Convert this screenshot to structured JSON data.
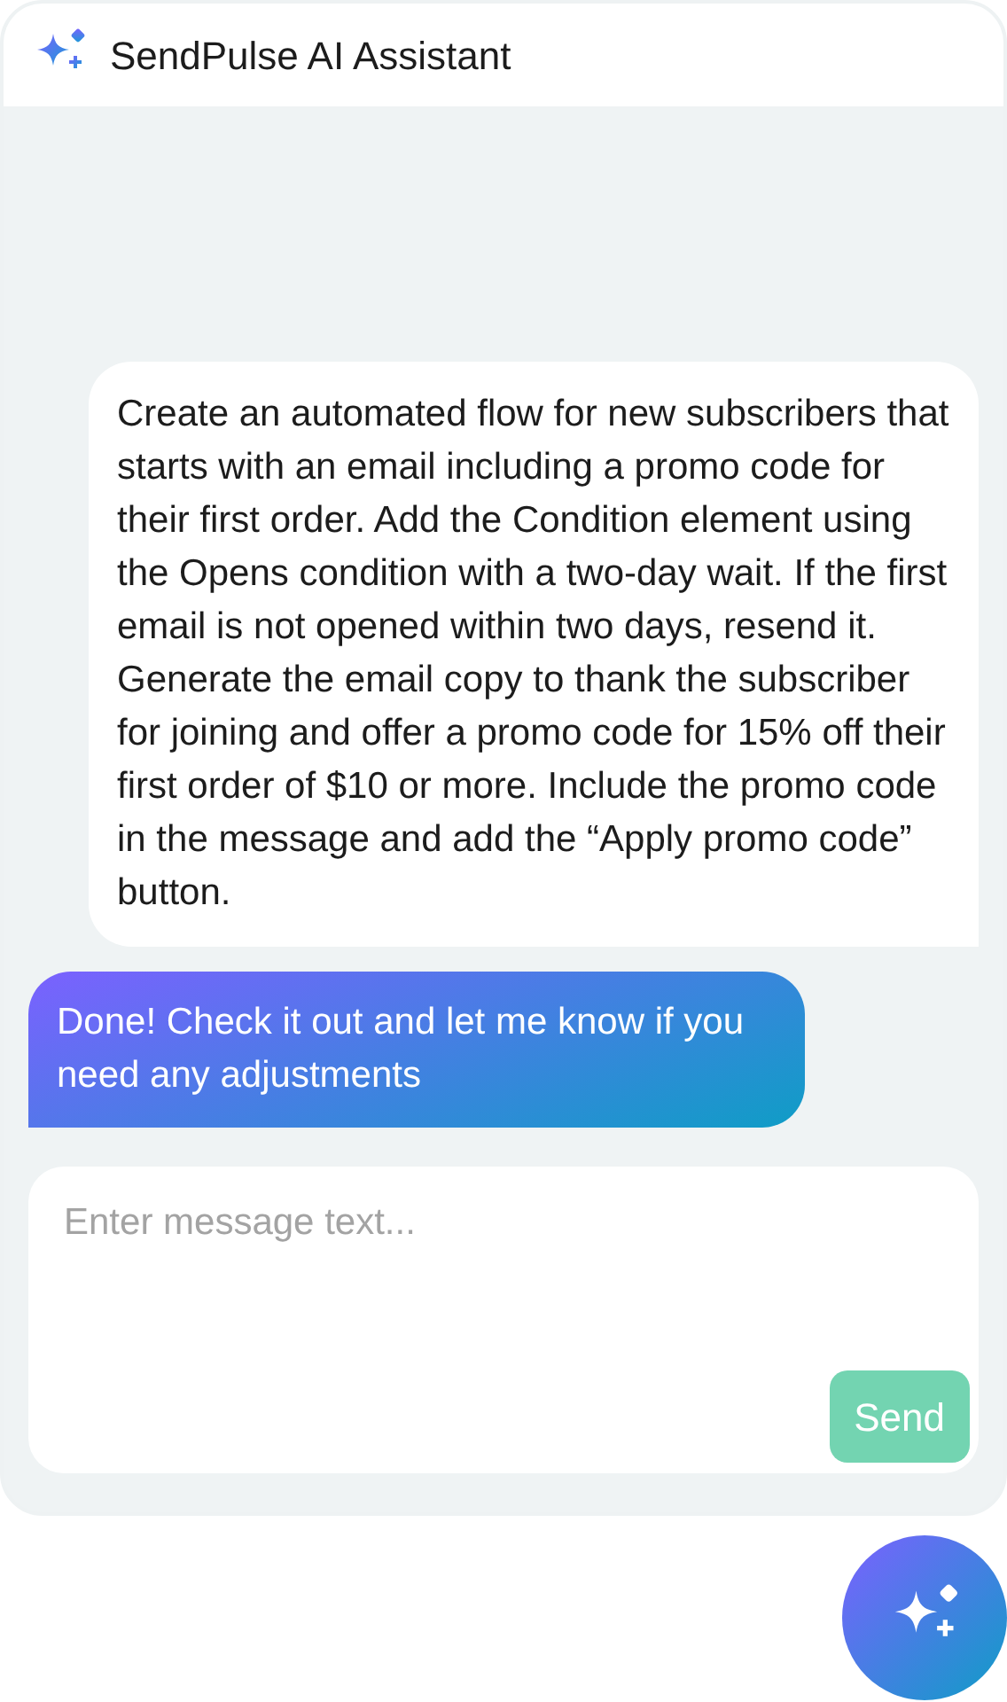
{
  "window": {
    "title": "SendPulse AI Assistant"
  },
  "messages": [
    {
      "kind": "user",
      "text": "Create an automated flow for new subscribers that starts with an email including a promo code for their first order. Add the Condition element using the Opens condition with a two-day wait. If the first email is not opened within two days, resend it. Generate the email copy to thank the subscriber for joining and offer a promo code for 15% off their first order of $10 or more. Include the promo code in the message and add the “Apply promo code” button."
    },
    {
      "kind": "assistant",
      "text": "Done! Check it out and let me know if you need any adjustments"
    }
  ],
  "composer": {
    "placeholder": "Enter message text...",
    "send_button": "Send"
  }
}
